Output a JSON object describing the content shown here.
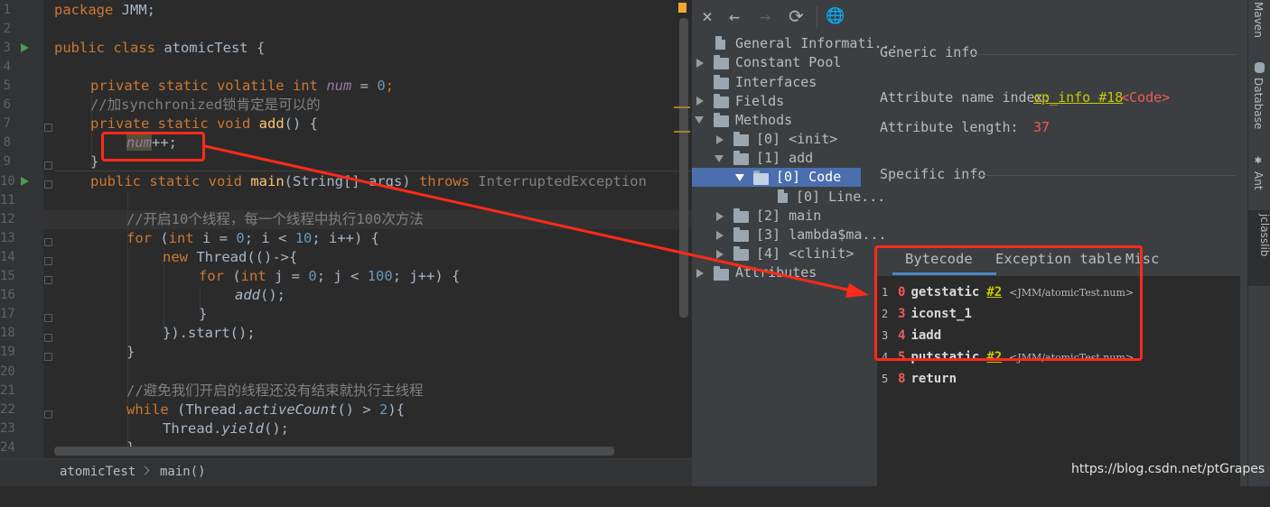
{
  "editor": {
    "line_numbers": [
      "1",
      "2",
      "3",
      "4",
      "5",
      "6",
      "7",
      "8",
      "9",
      "10",
      "11",
      "12",
      "13",
      "14",
      "15",
      "16",
      "17",
      "18",
      "19",
      "20",
      "21",
      "22",
      "23",
      "24"
    ],
    "code": {
      "l1_pkg_kw": "package",
      "l1_pkg_rest": " JMM;",
      "l3_kw": "public class",
      "l3_rest": " atomicTest {",
      "l5_kw": "private static volatile int",
      "l5_fld": "num",
      "l5_eq": " = ",
      "l5_num": "0",
      "l5_end": ";",
      "l6_comment": "//加synchronized锁肯定是可以的",
      "l7_kw": "private static void",
      "l7_fn": "add",
      "l7_rest": "() {",
      "l8_fld": "num",
      "l8_rest": "++;",
      "l9": "}",
      "l10_kw": "public static void",
      "l10_fn": "main",
      "l10_args": "(String[] args) ",
      "l10_throws": "throws",
      "l10_exc": " InterruptedException",
      "l12_comment": "//开启10个线程，每一个线程中执行100次方法",
      "l13_kw": "for",
      "l13_a": " (",
      "l13_int": "int",
      "l13_b": " i = ",
      "l13_n0": "0",
      "l13_c": "; i < ",
      "l13_n10": "10",
      "l13_d": "; i++) {",
      "l14_kw": "new",
      "l14_rest": " Thread(()->{",
      "l15_kw": "for",
      "l15_a": " (",
      "l15_int": "int",
      "l15_b": " j = ",
      "l15_n0": "0",
      "l15_c": "; j < ",
      "l15_n100": "100",
      "l15_d": "; j++) {",
      "l16_call": "add",
      "l16_rest": "();",
      "l17": "}",
      "l18": "}).start();",
      "l19": "}",
      "l21_comment": "//避免我们开启的线程还没有结束就执行主线程",
      "l22_kw": "while",
      "l22_a": " (Thread.",
      "l22_call": "activeCount",
      "l22_b": "() > ",
      "l22_n2": "2",
      "l22_c": "){",
      "l23_a": "Thread.",
      "l23_call": "yield",
      "l23_b": "();",
      "l24": "}"
    }
  },
  "breadcrumb": {
    "class_name": "atomicTest",
    "method_name": "main()"
  },
  "toolbar": {
    "close_icon": "×",
    "back_icon": "←",
    "forward_icon": "→",
    "refresh_icon": "⟳",
    "browser_icon": "🌐"
  },
  "tree": {
    "items": [
      "General Informati...",
      "Constant Pool",
      "Interfaces",
      "Fields",
      "Methods",
      "[0] <init>",
      "[1] add",
      "[0] Code",
      "[0] Line...",
      "[2] main",
      "[3] lambda$ma...",
      "[4] <clinit>",
      "Attributes"
    ]
  },
  "detail": {
    "generic_info": "Generic info",
    "attr_name_label": "Attribute name index:",
    "attr_name_link": "cp_info #18",
    "attr_name_value": "<Code>",
    "attr_length_label": "Attribute length:",
    "attr_length_value": "37",
    "specific_info": "Specific info",
    "tabs": [
      "Bytecode",
      "Exception table",
      "Misc"
    ],
    "bytecode": [
      {
        "line": "1",
        "offset": "0",
        "op": "getstatic",
        "ref": "#2",
        "comment": "<JMM/atomicTest.num>"
      },
      {
        "line": "2",
        "offset": "3",
        "op": "iconst_1",
        "ref": "",
        "comment": ""
      },
      {
        "line": "3",
        "offset": "4",
        "op": "iadd",
        "ref": "",
        "comment": ""
      },
      {
        "line": "4",
        "offset": "5",
        "op": "putstatic",
        "ref": "#2",
        "comment": "<JMM/atomicTest.num>"
      },
      {
        "line": "5",
        "offset": "8",
        "op": "return",
        "ref": "",
        "comment": ""
      }
    ]
  },
  "right_strip": {
    "maven": "Maven",
    "database": "Database",
    "ant": "Ant",
    "jclasslib": "jclasslib"
  },
  "watermark": "https://blog.csdn.net/ptGrapes",
  "colors": {
    "accent_selection": "#4b6eaf",
    "annotation_red": "#ff2a1a",
    "keyword": "#cc7832",
    "number": "#6897bb",
    "field": "#9876aa"
  }
}
